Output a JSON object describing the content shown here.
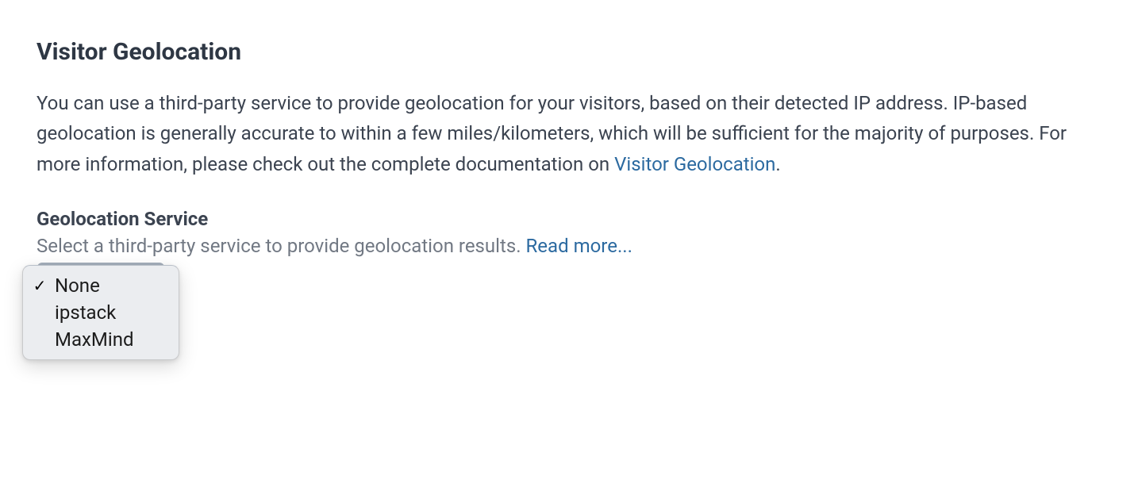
{
  "section": {
    "title": "Visitor Geolocation",
    "description_pre": "You can use a third-party service to provide geolocation for your visitors, based on their detected IP address. IP-based geolocation is generally accurate to within a few miles/kilometers, which will be sufficient for the majority of purposes. For more information, please check out the complete documentation on ",
    "description_link": "Visitor Geolocation",
    "description_post": "."
  },
  "field": {
    "label": "Geolocation Service",
    "help_pre": "Select a third-party service to provide geolocation results. ",
    "help_link": "Read more..."
  },
  "dropdown": {
    "options": [
      {
        "label": "None",
        "selected": true
      },
      {
        "label": "ipstack",
        "selected": false
      },
      {
        "label": "MaxMind",
        "selected": false
      }
    ]
  }
}
